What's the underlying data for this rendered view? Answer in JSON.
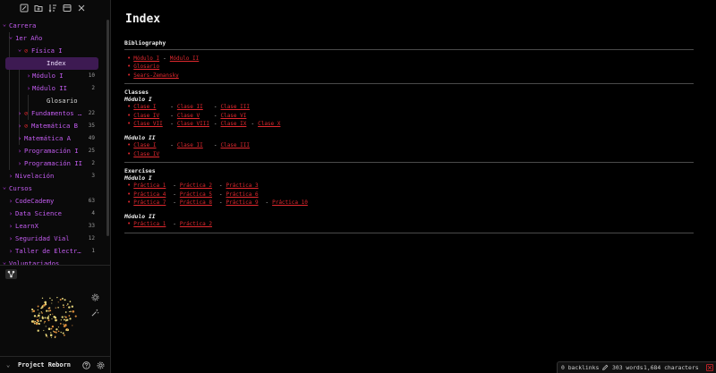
{
  "toolbar": {
    "icons": [
      "new-note-icon",
      "new-folder-icon",
      "sort-icon",
      "collapse-icon",
      "close-icon"
    ]
  },
  "sidebar": {
    "tree": [
      {
        "label": "Carrera",
        "kind": "folder",
        "depth": 0,
        "open": true
      },
      {
        "label": "1er Año",
        "kind": "folder",
        "depth": 1,
        "open": true
      },
      {
        "label": "Física I",
        "kind": "folder",
        "depth": 2,
        "open": true,
        "linked": true
      },
      {
        "label": "Index",
        "kind": "file",
        "depth": 3,
        "active": true
      },
      {
        "label": "Módulo I",
        "kind": "folder",
        "depth": 3,
        "open": false,
        "count": "10"
      },
      {
        "label": "Módulo II",
        "kind": "folder",
        "depth": 3,
        "open": false,
        "count": "2"
      },
      {
        "label": "Glosario",
        "kind": "file",
        "depth": 3
      },
      {
        "label": "Fundamentos d…",
        "kind": "folder",
        "depth": 2,
        "open": false,
        "linked": true,
        "count": "22"
      },
      {
        "label": "Matemática B",
        "kind": "folder",
        "depth": 2,
        "open": false,
        "linked": true,
        "count": "35"
      },
      {
        "label": "Matemática A",
        "kind": "folder",
        "depth": 2,
        "open": false,
        "count": "49"
      },
      {
        "label": "Programación I",
        "kind": "folder",
        "depth": 2,
        "open": false,
        "count": "25"
      },
      {
        "label": "Programación II",
        "kind": "folder",
        "depth": 2,
        "open": false,
        "count": "2"
      },
      {
        "label": "Nivelación",
        "kind": "folder",
        "depth": 1,
        "open": false,
        "count": "3"
      },
      {
        "label": "Cursos",
        "kind": "folder",
        "depth": 0,
        "open": true
      },
      {
        "label": "CodeCademy",
        "kind": "folder",
        "depth": 1,
        "open": false,
        "count": "63"
      },
      {
        "label": "Data Science",
        "kind": "folder",
        "depth": 1,
        "open": false,
        "count": "4"
      },
      {
        "label": "LearnX",
        "kind": "folder",
        "depth": 1,
        "open": false,
        "count": "33"
      },
      {
        "label": "Seguridad Vial",
        "kind": "folder",
        "depth": 1,
        "open": false,
        "count": "12"
      },
      {
        "label": "Taller de Electrón…",
        "kind": "folder",
        "depth": 1,
        "open": false,
        "count": "1"
      },
      {
        "label": "Voluntariados",
        "kind": "folder",
        "depth": 0,
        "open": true
      }
    ],
    "graph_panel": {
      "button_icon": "graph-view-icon",
      "settings_icon": "gear-icon",
      "animate_icon": "magic-wand-icon"
    },
    "vault": {
      "name": "Project Reborn",
      "help_icon": "help-icon",
      "settings_icon": "gear-icon"
    }
  },
  "page": {
    "title": "Index",
    "bibliography": {
      "title": "Bibliography",
      "items": [
        [
          "Módulo I",
          "Módulo II"
        ],
        [
          "Glosario"
        ],
        [
          "Sears-Zemansky"
        ]
      ]
    },
    "classes": {
      "title": "Classes",
      "modules": [
        {
          "title": "Módulo I",
          "rows": [
            [
              "Clase I",
              "Clase II",
              "Clase III"
            ],
            [
              "Clase IV",
              "Clase V",
              "Clase VI"
            ],
            [
              "Clase VII",
              "Clase VIII",
              "Clase IX",
              "Clase X"
            ]
          ]
        },
        {
          "title": "Módulo II",
          "rows": [
            [
              "Clase I",
              "Clase II",
              "Clase III"
            ],
            [
              "Clase IV"
            ]
          ]
        }
      ]
    },
    "exercises": {
      "title": "Exercises",
      "modules": [
        {
          "title": "Módulo I",
          "rows": [
            [
              "Práctica 1",
              "Práctica 2",
              "Práctica 3"
            ],
            [
              "Práctica 4",
              "Práctica 5",
              "Práctica 6"
            ],
            [
              "Práctica 7",
              "Práctica 8",
              "Práctica 9",
              "Práctica 10"
            ]
          ]
        },
        {
          "title": "Módulo II",
          "rows": [
            [
              "Práctica 1",
              "Práctica 2"
            ]
          ]
        }
      ]
    }
  },
  "status": {
    "backlinks": "0 backlinks",
    "words": "303 words",
    "characters": "1,684 characters",
    "edit_icon": "pencil-icon",
    "sync_icon": "sync-icon"
  },
  "colors": {
    "accent": "#c35cf0",
    "link": "#e0282e",
    "active_bg": "#3d1a52",
    "background": "#000000"
  }
}
